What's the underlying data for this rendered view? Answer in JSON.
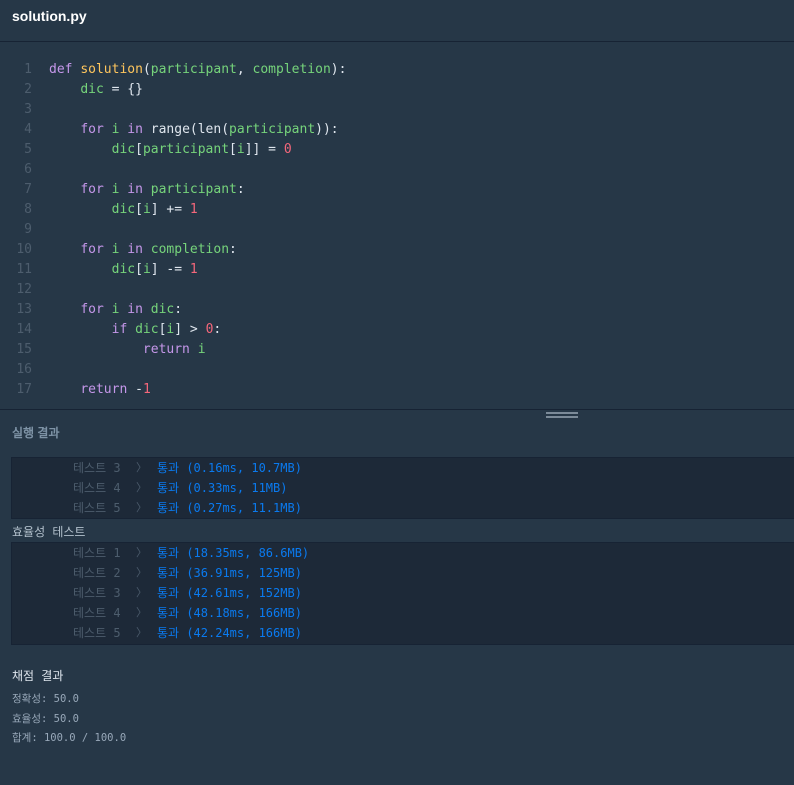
{
  "tab": {
    "title": "solution.py"
  },
  "editor": {
    "lines": [
      {
        "n": "1",
        "code": [
          [
            "kw",
            "def "
          ],
          [
            "fn",
            "solution"
          ],
          [
            "plain",
            "("
          ],
          [
            "param",
            "participant"
          ],
          [
            "plain",
            ", "
          ],
          [
            "param",
            "completion"
          ],
          [
            "plain",
            "):"
          ]
        ]
      },
      {
        "n": "2",
        "code": [
          [
            "plain",
            "    "
          ],
          [
            "param",
            "dic"
          ],
          [
            "plain",
            " = {}"
          ]
        ]
      },
      {
        "n": "3",
        "code": []
      },
      {
        "n": "4",
        "code": [
          [
            "plain",
            "    "
          ],
          [
            "kw",
            "for "
          ],
          [
            "param",
            "i"
          ],
          [
            "kw",
            " in "
          ],
          [
            "plain",
            "range(len("
          ],
          [
            "param",
            "participant"
          ],
          [
            "plain",
            "))"
          ],
          [
            "plain",
            ":"
          ]
        ]
      },
      {
        "n": "5",
        "code": [
          [
            "plain",
            "        "
          ],
          [
            "param",
            "dic"
          ],
          [
            "plain",
            "["
          ],
          [
            "param",
            "participant"
          ],
          [
            "plain",
            "["
          ],
          [
            "param",
            "i"
          ],
          [
            "plain",
            "]] = "
          ],
          [
            "num",
            "0"
          ]
        ]
      },
      {
        "n": "6",
        "code": []
      },
      {
        "n": "7",
        "code": [
          [
            "plain",
            "    "
          ],
          [
            "kw",
            "for "
          ],
          [
            "param",
            "i"
          ],
          [
            "kw",
            " in "
          ],
          [
            "param",
            "participant"
          ],
          [
            "plain",
            ":"
          ]
        ]
      },
      {
        "n": "8",
        "code": [
          [
            "plain",
            "        "
          ],
          [
            "param",
            "dic"
          ],
          [
            "plain",
            "["
          ],
          [
            "param",
            "i"
          ],
          [
            "plain",
            "] += "
          ],
          [
            "num",
            "1"
          ]
        ]
      },
      {
        "n": "9",
        "code": []
      },
      {
        "n": "10",
        "code": [
          [
            "plain",
            "    "
          ],
          [
            "kw",
            "for "
          ],
          [
            "param",
            "i"
          ],
          [
            "kw",
            " in "
          ],
          [
            "param",
            "completion"
          ],
          [
            "plain",
            ":"
          ]
        ]
      },
      {
        "n": "11",
        "code": [
          [
            "plain",
            "        "
          ],
          [
            "param",
            "dic"
          ],
          [
            "plain",
            "["
          ],
          [
            "param",
            "i"
          ],
          [
            "plain",
            "] -= "
          ],
          [
            "num",
            "1"
          ]
        ]
      },
      {
        "n": "12",
        "code": []
      },
      {
        "n": "13",
        "code": [
          [
            "plain",
            "    "
          ],
          [
            "kw",
            "for "
          ],
          [
            "param",
            "i"
          ],
          [
            "kw",
            " in "
          ],
          [
            "param",
            "dic"
          ],
          [
            "plain",
            ":"
          ]
        ]
      },
      {
        "n": "14",
        "code": [
          [
            "plain",
            "        "
          ],
          [
            "kw",
            "if "
          ],
          [
            "param",
            "dic"
          ],
          [
            "plain",
            "["
          ],
          [
            "param",
            "i"
          ],
          [
            "plain",
            "] > "
          ],
          [
            "num",
            "0"
          ],
          [
            "plain",
            ":"
          ]
        ]
      },
      {
        "n": "15",
        "code": [
          [
            "plain",
            "            "
          ],
          [
            "kw",
            "return "
          ],
          [
            "param",
            "i"
          ]
        ]
      },
      {
        "n": "16",
        "code": []
      },
      {
        "n": "17",
        "code": [
          [
            "plain",
            "    "
          ],
          [
            "kw",
            "return "
          ],
          [
            "plain",
            "-"
          ],
          [
            "num",
            "1"
          ]
        ]
      }
    ]
  },
  "results": {
    "header": "실행 결과",
    "group1": [
      {
        "label": "테스트 3",
        "chev": "〉",
        "status": "통과",
        "detail": "(0.16ms, 10.7MB)"
      },
      {
        "label": "테스트 4",
        "chev": "〉",
        "status": "통과",
        "detail": "(0.33ms, 11MB)"
      },
      {
        "label": "테스트 5",
        "chev": "〉",
        "status": "통과",
        "detail": "(0.27ms, 11.1MB)"
      }
    ],
    "efficiency_label": "효율성  테스트",
    "group2": [
      {
        "label": "테스트 1",
        "chev": "〉",
        "status": "통과",
        "detail": "(18.35ms, 86.6MB)"
      },
      {
        "label": "테스트 2",
        "chev": "〉",
        "status": "통과",
        "detail": "(36.91ms, 125MB)"
      },
      {
        "label": "테스트 3",
        "chev": "〉",
        "status": "통과",
        "detail": "(42.61ms, 152MB)"
      },
      {
        "label": "테스트 4",
        "chev": "〉",
        "status": "통과",
        "detail": "(48.18ms, 166MB)"
      },
      {
        "label": "테스트 5",
        "chev": "〉",
        "status": "통과",
        "detail": "(42.24ms, 166MB)"
      }
    ],
    "summary": {
      "title": "채점 결과",
      "accuracy_label": "정확성: ",
      "accuracy_value": "50.0",
      "efficiency_label": "효율성: ",
      "efficiency_value": "50.0",
      "total_label": "합계: ",
      "total_value": "100.0 / 100.0"
    }
  }
}
